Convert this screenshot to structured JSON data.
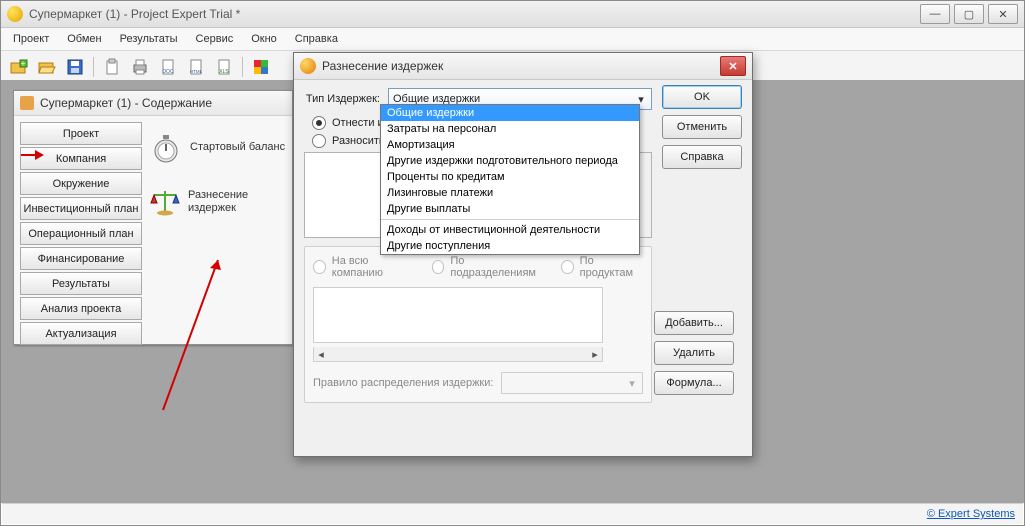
{
  "app": {
    "title": "Супермаркет (1) - Project Expert Trial *"
  },
  "menu": {
    "m0": "Проект",
    "m1": "Обмен",
    "m2": "Результаты",
    "m3": "Сервис",
    "m4": "Окно",
    "m5": "Справка"
  },
  "child": {
    "title": "Супермаркет (1) - Содержание",
    "nav": {
      "n0": "Проект",
      "n1": "Компания",
      "n2": "Окружение",
      "n3": "Инвестиционный план",
      "n4": "Операционный план",
      "n5": "Финансирование",
      "n6": "Результаты",
      "n7": "Анализ проекта",
      "n8": "Актуализация"
    },
    "desc": {
      "d0": "Стартовый баланс",
      "d1": "Разнесение издержек"
    }
  },
  "dialog": {
    "title": "Разнесение издержек",
    "type_label": "Тип Издержек:",
    "combo_value": "Общие издержки",
    "r1": "Отнести издержки на всю компанию",
    "r2": "Разносить издержки по схеме",
    "scope": {
      "s0": "На всю компанию",
      "s1": "По подразделениям",
      "s2": "По продуктам"
    },
    "rule": "Правило распределения издержки:",
    "buttons": {
      "ok": "OK",
      "cancel": "Отменить",
      "help": "Справка",
      "add": "Добавить...",
      "del": "Удалить",
      "formula": "Формула..."
    }
  },
  "dropdown": {
    "o0": "Общие издержки",
    "o1": "Затраты на персонал",
    "o2": "Амортизация",
    "o3": "Другие издержки подготовительного периода",
    "o4": "Проценты по кредитам",
    "o5": "Лизинговые платежи",
    "o6": "Другие выплаты",
    "o7": "Доходы от инвестиционной деятельности",
    "o8": "Другие поступления"
  },
  "status": {
    "link": "© Expert Systems"
  }
}
